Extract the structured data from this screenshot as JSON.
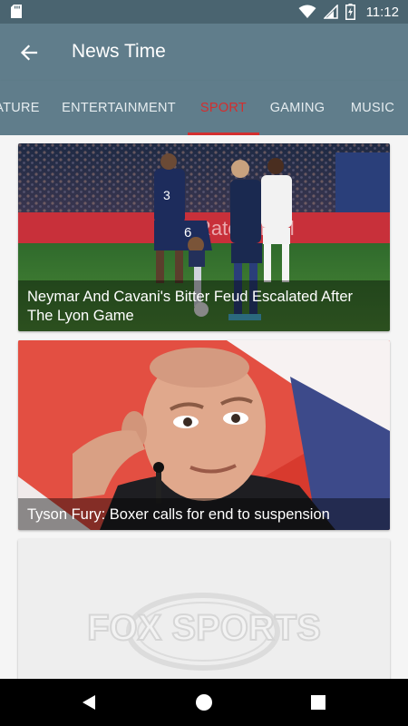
{
  "status_bar": {
    "time": "11:12",
    "icons": [
      "sd-card-icon",
      "wifi-icon",
      "signal-icon",
      "battery-charging-icon"
    ]
  },
  "app_bar": {
    "title": "News Time",
    "back_icon": "arrow-back-icon"
  },
  "tabs": [
    {
      "label": "FEATURE",
      "visible_label": "ATURE",
      "active": false
    },
    {
      "label": "ENTERTAINMENT",
      "active": false
    },
    {
      "label": "SPORT",
      "active": true
    },
    {
      "label": "GAMING",
      "active": false
    },
    {
      "label": "MUSIC",
      "active": false
    }
  ],
  "colors": {
    "status_bar": "#4a6470",
    "app_bar": "#607d8b",
    "accent": "#d32f2f",
    "background": "#f5f5f5"
  },
  "articles": [
    {
      "title": "Neymar And Cavani's Bitter Feud Escalated After The Lyon Game",
      "image": "football-match-photo"
    },
    {
      "title": "Tyson Fury: Boxer calls for end to suspension",
      "image": "boxer-portrait-photo"
    },
    {
      "title": "",
      "image": "fox-sports-logo-placeholder",
      "logo_text": "FOX SPORTS"
    }
  ],
  "nav_bar": {
    "buttons": [
      "back-triangle-icon",
      "home-circle-icon",
      "recents-square-icon"
    ]
  }
}
